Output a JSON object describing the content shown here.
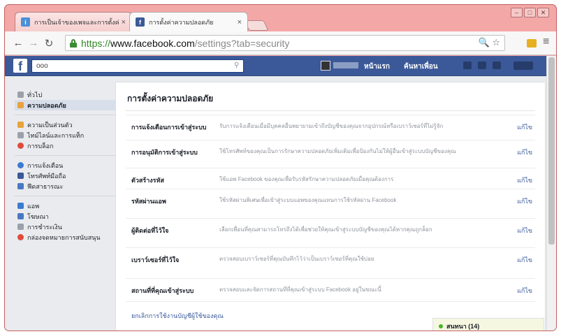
{
  "browser": {
    "tabs": [
      {
        "title": "การเป็นเจ้าของเพจและการตั้งค่า",
        "fav": "i"
      },
      {
        "title": "การตั้งค่าความปลอดภัย",
        "fav": "f"
      }
    ],
    "close_glyph": "×",
    "url": {
      "scheme": "https://",
      "host": "www.facebook.com",
      "path": "/settings?tab=security"
    }
  },
  "facebook": {
    "logo": "f",
    "search_value": "ooo",
    "nav": {
      "home": "หน้าแรก",
      "find_friends": "ค้นหาเพื่อน"
    },
    "sidebar": [
      {
        "label": "ทั่วไป",
        "color": "#9aa1ab",
        "selected": false
      },
      {
        "label": "ความปลอดภัย",
        "color": "#e8a33d",
        "selected": true
      },
      {
        "label": "ความเป็นส่วนตัว",
        "color": "#e8a33d",
        "selected": false
      },
      {
        "label": "ไทม์ไลน์และการแท็ก",
        "color": "#9aa1ab",
        "selected": false
      },
      {
        "label": "การบล็อก",
        "color": "#e04b3b",
        "selected": false
      },
      {
        "label": "การแจ้งเตือน",
        "color": "#3b7bd0",
        "selected": false
      },
      {
        "label": "โทรศัพท์มือถือ",
        "color": "#3b5998",
        "selected": false
      },
      {
        "label": "ฟีดสาธารณะ",
        "color": "#4a78c4",
        "selected": false
      },
      {
        "label": "แอพ",
        "color": "#3b7bd0",
        "selected": false
      },
      {
        "label": "โฆษณา",
        "color": "#4a78c4",
        "selected": false
      },
      {
        "label": "การชำระเงิน",
        "color": "#9aa1ab",
        "selected": false
      },
      {
        "label": "กล่องจดหมายการสนับสนุน",
        "color": "#e04b3b",
        "selected": false
      }
    ],
    "page_title": "การตั้งค่าความปลอดภัย",
    "settings_rows": [
      {
        "label": "การแจ้งเตือนการเข้าสู่ระบบ",
        "desc": "รับการแจ้งเตือนเมื่อมีบุคคลอื่นพยายามเข้าถึงบัญชีของคุณจากอุปกรณ์หรือเบราว์เซอร์ที่ไม่รู้จัก",
        "edit": "แก้ไข"
      },
      {
        "label": "การอนุมัติการเข้าสู่ระบบ",
        "desc": "ใช้โทรศัพท์ของคุณเป็นการรักษาความปลอดภัยเพิ่มเติมเพื่อป้องกันไม่ให้ผู้อื่นเข้าสู่ระบบบัญชีของคุณ",
        "edit": "แก้ไข"
      },
      {
        "label": "ตัวสร้างรหัส",
        "desc": "ใช้แอพ Facebook ของคุณเพื่อรับรหัสรักษาความปลอดภัยเมื่อคุณต้องการ",
        "edit": "แก้ไข"
      },
      {
        "label": "รหัสผ่านแอพ",
        "desc": "ใช้รหัสผ่านพิเศษเพื่อเข้าสู่ระบบแอพของคุณแทนการใช้รหัสผ่าน Facebook",
        "edit": "แก้ไข"
      },
      {
        "label": "ผู้ติดต่อที่ไว้ใจ",
        "desc": "เลือกเพื่อนที่คุณสามารถโทรถึงได้เพื่อช่วยให้คุณเข้าสู่ระบบบัญชีของคุณได้หากคุณถูกล็อก",
        "edit": "แก้ไข"
      },
      {
        "label": "เบราว์เซอร์ที่ไว้ใจ",
        "desc": "ตรวจสอบเบราว์เซอร์ที่คุณบันทึกไว้ว่าเป็นเบราว์เซอร์ที่คุณใช้บ่อย",
        "edit": "แก้ไข"
      },
      {
        "label": "สถานที่ที่คุณเข้าสู่ระบบ",
        "desc": "ตรวจสอบและจัดการสถานที่ที่คุณเข้าสู่ระบบ Facebook อยู่ในขณะนี้",
        "edit": "แก้ไข"
      }
    ],
    "deactivate_link": "ยกเลิกการใช้งานบัญชีผู้ใช้ของคุณ",
    "chat_label": "สนทนา (14)"
  }
}
